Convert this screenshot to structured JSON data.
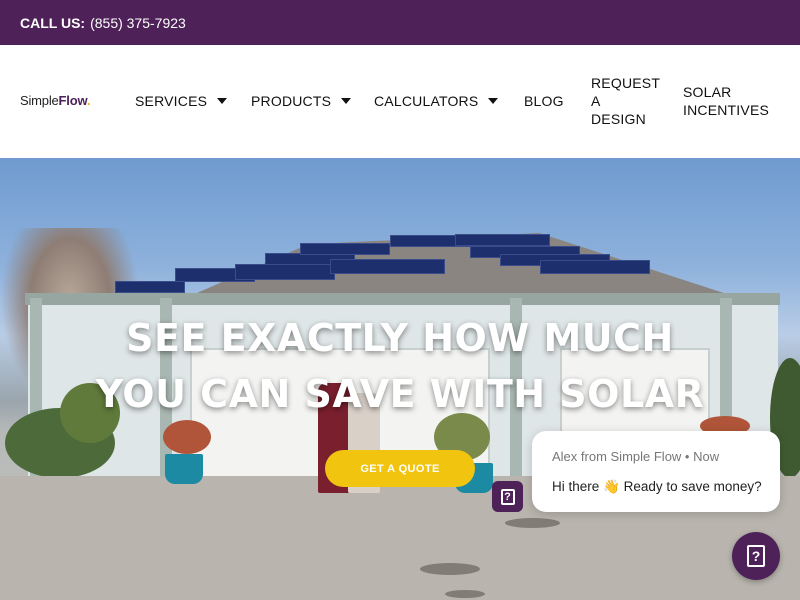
{
  "topbar": {
    "call_label": "CALL US:",
    "phone": "(855) 375-7923"
  },
  "logo": {
    "part1": "Simple",
    "part2": "Flow",
    "dot": "."
  },
  "nav": {
    "services": "SERVICES",
    "products": "PRODUCTS",
    "calculators": "CALCULATORS",
    "blog": "BLOG",
    "request_design": [
      "REQUEST",
      "A",
      "DESIGN"
    ],
    "solar_incentives": [
      "SOLAR",
      "INCENTIVES"
    ]
  },
  "hero": {
    "title_line1": "SEE EXACTLY HOW MUCH",
    "title_line2": "YOU CAN SAVE WITH SOLAR",
    "cta_label": "GET A QUOTE"
  },
  "chat": {
    "from": "Alex from Simple Flow • Now",
    "message": "Hi there 👋 Ready to save money?",
    "icon": "question-mark"
  },
  "colors": {
    "brand": "#4e2158",
    "accent": "#f1c40f"
  }
}
